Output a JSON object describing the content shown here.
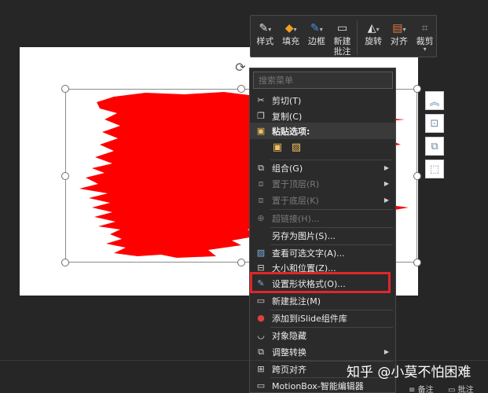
{
  "mini_toolbar": {
    "buttons": [
      {
        "label": "样式",
        "icon": "style-pen-icon"
      },
      {
        "label": "填充",
        "icon": "fill-bucket-icon"
      },
      {
        "label": "边框",
        "icon": "border-pen-icon"
      },
      {
        "label": "新建\n批注",
        "icon": "new-comment-icon"
      },
      {
        "label": "旋转",
        "icon": "rotate-icon"
      },
      {
        "label": "对齐",
        "icon": "align-icon"
      },
      {
        "label": "裁剪",
        "icon": "crop-icon"
      }
    ]
  },
  "context_menu": {
    "search_placeholder": "搜索菜单",
    "items": [
      {
        "label": "剪切(T)",
        "icon": "scissors-icon",
        "enabled": true
      },
      {
        "label": "复制(C)",
        "icon": "copy-icon",
        "enabled": true
      },
      {
        "label": "粘贴选项:",
        "icon": "paste-icon",
        "enabled": true
      },
      {
        "label": "组合(G)",
        "icon": "group-icon",
        "enabled": true,
        "submenu": true
      },
      {
        "label": "置于顶层(R)",
        "icon": "bring-front-icon",
        "enabled": false,
        "submenu": true
      },
      {
        "label": "置于底层(K)",
        "icon": "send-back-icon",
        "enabled": false,
        "submenu": true
      },
      {
        "label": "超链接(H)...",
        "icon": "link-icon",
        "enabled": false
      },
      {
        "label": "另存为图片(S)...",
        "icon": "",
        "enabled": true
      },
      {
        "label": "查看可选文字(A)...",
        "icon": "alt-text-icon",
        "enabled": true
      },
      {
        "label": "大小和位置(Z)...",
        "icon": "size-position-icon",
        "enabled": true
      },
      {
        "label": "设置形状格式(O)...",
        "icon": "format-shape-icon",
        "enabled": true
      },
      {
        "label": "新建批注(M)",
        "icon": "new-comment-icon",
        "enabled": true
      },
      {
        "label": "添加到iSlide组件库",
        "icon": "islide-icon",
        "enabled": true
      },
      {
        "label": "对象隐藏",
        "icon": "hide-eye-icon",
        "enabled": true
      },
      {
        "label": "调整转换",
        "icon": "convert-icon",
        "enabled": true,
        "submenu": true
      },
      {
        "label": "跨页对齐",
        "icon": "cross-page-align-icon",
        "enabled": true
      },
      {
        "label": "MotionBox-智能编辑器",
        "icon": "motionbox-icon",
        "enabled": true
      }
    ]
  },
  "watermark": "知乎 @小莫不怕困难",
  "status": {
    "notes_label": "备注",
    "comments_label": "批注"
  },
  "colors": {
    "brush_red": "#ff0000",
    "highlight_red": "#e0262a",
    "menu_bg": "#2b2b2b"
  }
}
